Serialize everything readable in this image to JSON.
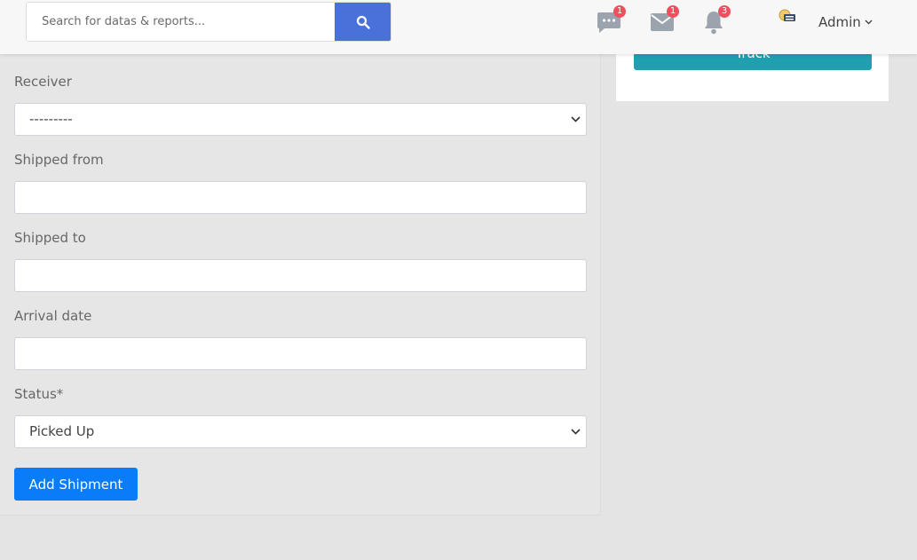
{
  "header": {
    "search_placeholder": "Search for datas & reports...",
    "icons": [
      {
        "name": "chat-icon",
        "badge": "1"
      },
      {
        "name": "mail-icon",
        "badge": "1"
      },
      {
        "name": "bell-icon",
        "badge": "3"
      }
    ],
    "user_label": "Admin"
  },
  "form": {
    "receiver": {
      "label": "Receiver",
      "value": "---------"
    },
    "shipped_from": {
      "label": "Shipped from",
      "value": ""
    },
    "shipped_to": {
      "label": "Shipped to",
      "value": ""
    },
    "arrival_date": {
      "label": "Arrival date",
      "value": ""
    },
    "status": {
      "label": "Status*",
      "value": "Picked Up"
    },
    "submit_label": "Add Shipment"
  },
  "track_card": {
    "button_label": "Track"
  },
  "colors": {
    "primary_button": "#0b7cf9",
    "search_button": "#4a71da",
    "track_button": "#1f9fb0",
    "badge": "#ef4f5f",
    "nav_icon": "#9aa3ae"
  }
}
